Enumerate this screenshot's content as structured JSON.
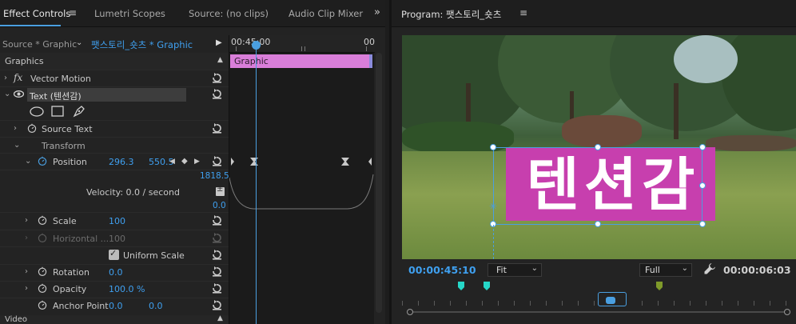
{
  "left_panel": {
    "tabs": {
      "effect_controls": "Effect Controls",
      "lumetri_scopes": "Lumetri Scopes",
      "source": "Source: (no clips)",
      "audio_mixer": "Audio Clip Mixer"
    },
    "source_label": "Source * Graphic",
    "clip_label": "팻스토리_숏츠 * Graphic",
    "timeline": {
      "time_start": "00:45:00",
      "time_end": "00",
      "clip_name": "Graphic"
    },
    "graphics_header": "Graphics",
    "vector_motion": "Vector Motion",
    "text_layer": "Text (텐션감)",
    "source_text": "Source Text",
    "transform": "Transform",
    "position": {
      "label": "Position",
      "x": "296.3",
      "y": "550.5"
    },
    "velocity": {
      "label": "Velocity: 0.0 / second",
      "top": "1818.5",
      "bottom": "0.0"
    },
    "scale": {
      "label": "Scale",
      "value": "100"
    },
    "horizontal": {
      "label": "Horizontal ...",
      "value": "100"
    },
    "uniform_scale": "Uniform Scale",
    "rotation": {
      "label": "Rotation",
      "value": "0.0"
    },
    "opacity": {
      "label": "Opacity",
      "value": "100.0 %"
    },
    "anchor_point": {
      "label": "Anchor Point",
      "x": "0.0",
      "y": "0.0"
    },
    "video_label": "Video"
  },
  "program": {
    "title": "Program: 팻스토리_숏츠",
    "title_overlay": "텐션감",
    "current_time": "00:00:45:10",
    "fit": "Fit",
    "quality": "Full",
    "duration": "00:00:06:03"
  },
  "colors": {
    "accent": "#4a9fe0",
    "graphic_clip": "#d97ed9",
    "title_bg": "#c73fae",
    "marker_cyan": "#26d7c8",
    "marker_olive": "#7f9a2a"
  },
  "icons": [
    "menu-icon",
    "more-panels-icon",
    "chevron-down-icon",
    "play-icon",
    "fx-icon",
    "eye-icon",
    "ellipse-tool-icon",
    "rectangle-tool-icon",
    "pen-tool-icon",
    "stopwatch-icon",
    "reset-icon",
    "keyframe-prev-icon",
    "keyframe-add-icon",
    "keyframe-next-icon",
    "wrench-icon"
  ]
}
